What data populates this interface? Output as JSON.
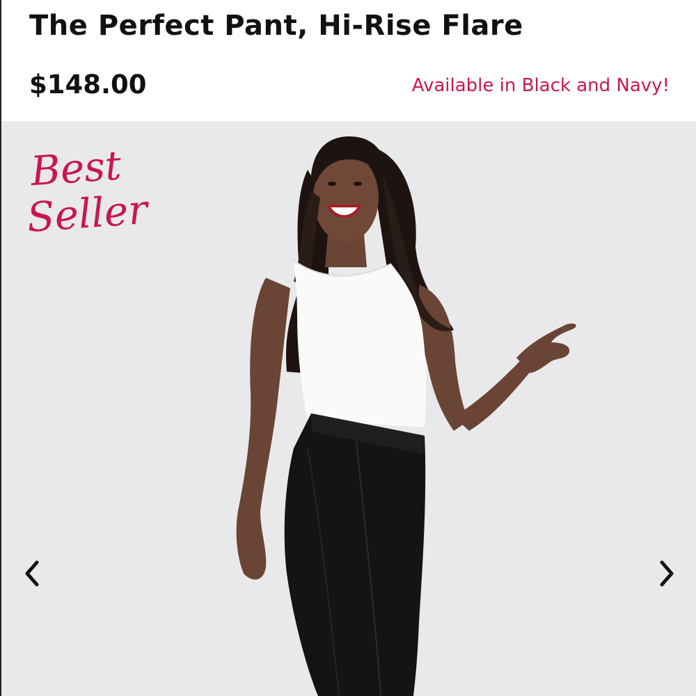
{
  "product": {
    "title": "The Perfect Pant, Hi-Rise Flare",
    "price": "$148.00",
    "availability": "Available in Black and Navy!"
  },
  "gallery": {
    "badge_line1": "Best",
    "badge_line2": "Seller",
    "prev_icon": "chevron-left-icon",
    "next_icon": "chevron-right-icon"
  },
  "colors": {
    "accent": "#c8174f",
    "text": "#111111",
    "photo_background": "#e9e9eb"
  }
}
